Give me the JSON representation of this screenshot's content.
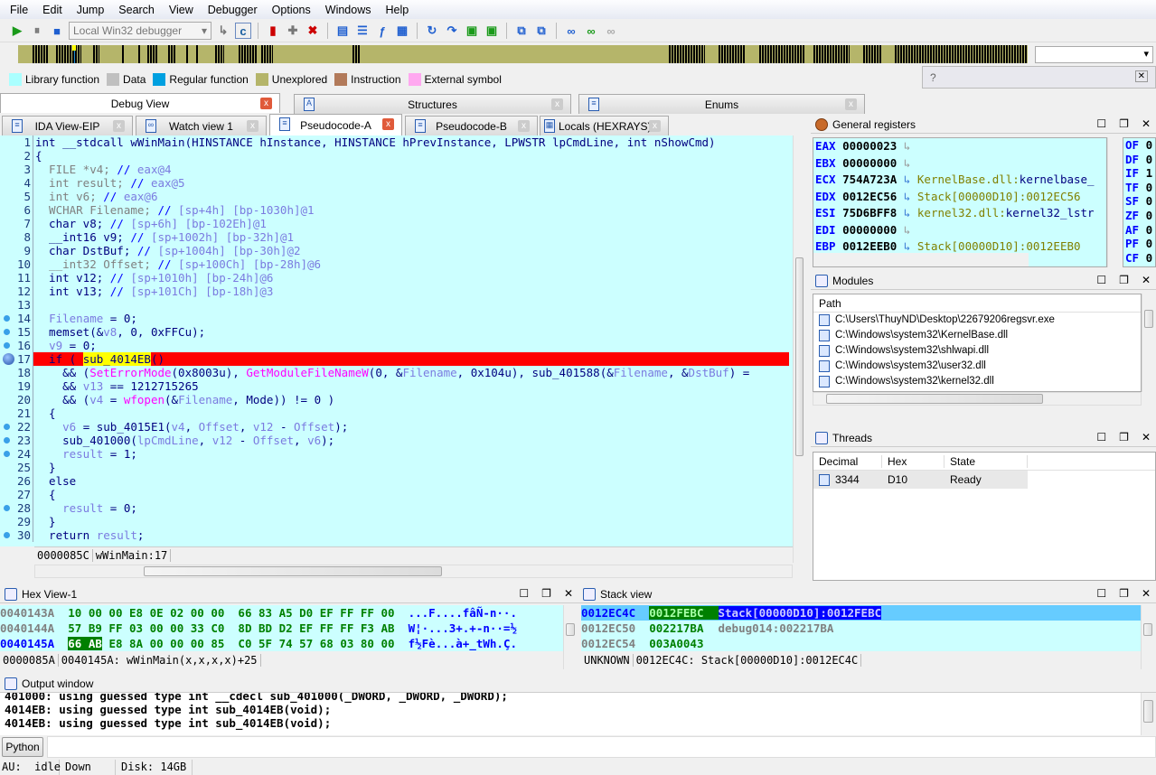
{
  "menu": [
    "File",
    "Edit",
    "Jump",
    "Search",
    "View",
    "Debugger",
    "Options",
    "Windows",
    "Help"
  ],
  "toolbar": {
    "debugger_select": "Local Win32 debugger"
  },
  "legend": [
    {
      "label": "Library function",
      "color": "#aaffff"
    },
    {
      "label": "Data",
      "color": "#c0c0c0"
    },
    {
      "label": "Regular function",
      "color": "#00a0e0"
    },
    {
      "label": "Unexplored",
      "color": "#b5b56a"
    },
    {
      "label": "Instruction",
      "color": "#b27a5a"
    },
    {
      "label": "External symbol",
      "color": "#ffa8f0"
    }
  ],
  "help": "?",
  "top_tabs": [
    {
      "label": "Debug View",
      "active": true
    },
    {
      "label": "Structures"
    },
    {
      "label": "Enums"
    }
  ],
  "view_tabs": [
    {
      "label": "IDA View-EIP"
    },
    {
      "label": "Watch view 1"
    },
    {
      "label": "Pseudocode-A",
      "active": true
    },
    {
      "label": "Pseudocode-B"
    },
    {
      "label": "Locals (HEXRAYS)"
    }
  ],
  "code": {
    "lines": [
      {
        "n": "1",
        "s": [
          [
            "int __stdcall wWinMain(HINSTANCE hInstance, HINSTANCE hPrevInstance, LPWSTR lpCmdLine, int nShowCmd)",
            "n"
          ]
        ]
      },
      {
        "n": "2",
        "s": [
          [
            "{",
            "n"
          ]
        ]
      },
      {
        "n": "3",
        "s": [
          [
            "  FILE *v4;",
            "g"
          ],
          [
            " // ",
            "c"
          ],
          [
            "eax@4",
            "v"
          ]
        ]
      },
      {
        "n": "4",
        "s": [
          [
            "  int result;",
            "g"
          ],
          [
            " // ",
            "c"
          ],
          [
            "eax@5",
            "v"
          ]
        ]
      },
      {
        "n": "5",
        "s": [
          [
            "  int v6;",
            "g"
          ],
          [
            " // ",
            "c"
          ],
          [
            "eax@6",
            "v"
          ]
        ]
      },
      {
        "n": "6",
        "s": [
          [
            "  WCHAR Filename;",
            "g"
          ],
          [
            " // ",
            "c"
          ],
          [
            "[sp+4h] [bp-1030h]@1",
            "v"
          ]
        ]
      },
      {
        "n": "7",
        "s": [
          [
            "  char v8;",
            "n"
          ],
          [
            " // ",
            "c"
          ],
          [
            "[sp+6h] [bp-102Eh]@1",
            "v"
          ]
        ]
      },
      {
        "n": "8",
        "s": [
          [
            "  __int16 v9;",
            "n"
          ],
          [
            " // ",
            "c"
          ],
          [
            "[sp+1002h] [bp-32h]@1",
            "v"
          ]
        ]
      },
      {
        "n": "9",
        "s": [
          [
            "  char DstBuf;",
            "n"
          ],
          [
            " // ",
            "c"
          ],
          [
            "[sp+1004h] [bp-30h]@2",
            "v"
          ]
        ]
      },
      {
        "n": "10",
        "s": [
          [
            "  __int32 Offset;",
            "g"
          ],
          [
            " // ",
            "c"
          ],
          [
            "[sp+100Ch] [bp-28h]@6",
            "v"
          ]
        ]
      },
      {
        "n": "11",
        "s": [
          [
            "  int v12;",
            "n"
          ],
          [
            " // ",
            "c"
          ],
          [
            "[sp+1010h] [bp-24h]@6",
            "v"
          ]
        ]
      },
      {
        "n": "12",
        "s": [
          [
            "  int v13;",
            "n"
          ],
          [
            " // ",
            "c"
          ],
          [
            "[sp+101Ch] [bp-18h]@3",
            "v"
          ]
        ]
      },
      {
        "n": "13",
        "s": [
          [
            "",
            "n"
          ]
        ]
      },
      {
        "n": "14",
        "dot": true,
        "s": [
          [
            "  ",
            "n"
          ],
          [
            "Filename",
            "v"
          ],
          [
            " = 0;",
            "n"
          ]
        ]
      },
      {
        "n": "15",
        "dot": true,
        "s": [
          [
            "  memset(&",
            "n"
          ],
          [
            "v8",
            "v"
          ],
          [
            ", 0, 0xFFCu);",
            "n"
          ]
        ]
      },
      {
        "n": "16",
        "dot": true,
        "s": [
          [
            "  ",
            "n"
          ],
          [
            "v9",
            "v"
          ],
          [
            " = 0;",
            "n"
          ]
        ]
      },
      {
        "n": "17",
        "bp": true,
        "hl": true,
        "s": [
          [
            "  if ( ",
            "n"
          ],
          [
            "sub_4014EB",
            "y"
          ],
          [
            "()",
            "n"
          ]
        ]
      },
      {
        "n": "18",
        "s": [
          [
            "    && (",
            "n"
          ],
          [
            "SetErrorMode",
            "f"
          ],
          [
            "(0x8003u), ",
            "n"
          ],
          [
            "GetModuleFileNameW",
            "f"
          ],
          [
            "(0, &",
            "n"
          ],
          [
            "Filename",
            "v"
          ],
          [
            ", 0x104u), sub_401588(&",
            "n"
          ],
          [
            "Filename",
            "v"
          ],
          [
            ", &",
            "n"
          ],
          [
            "DstBuf",
            "v"
          ],
          [
            ") =",
            "n"
          ]
        ]
      },
      {
        "n": "19",
        "s": [
          [
            "    && ",
            "n"
          ],
          [
            "v13",
            "v"
          ],
          [
            " == 1212715265",
            "n"
          ]
        ]
      },
      {
        "n": "20",
        "s": [
          [
            "    && (",
            "n"
          ],
          [
            "v4",
            "v"
          ],
          [
            " = ",
            "n"
          ],
          [
            "wfopen",
            "f"
          ],
          [
            "(&",
            "n"
          ],
          [
            "Filename",
            "v"
          ],
          [
            ", Mode)) != 0 )",
            "n"
          ]
        ]
      },
      {
        "n": "21",
        "s": [
          [
            "  {",
            "n"
          ]
        ]
      },
      {
        "n": "22",
        "dot": true,
        "s": [
          [
            "    ",
            "n"
          ],
          [
            "v6",
            "v"
          ],
          [
            " = sub_4015E1(",
            "n"
          ],
          [
            "v4",
            "v"
          ],
          [
            ", ",
            "n"
          ],
          [
            "Offset",
            "v"
          ],
          [
            ", ",
            "n"
          ],
          [
            "v12",
            "v"
          ],
          [
            " - ",
            "n"
          ],
          [
            "Offset",
            "v"
          ],
          [
            ");",
            "n"
          ]
        ]
      },
      {
        "n": "23",
        "dot": true,
        "s": [
          [
            "    sub_401000(",
            "n"
          ],
          [
            "lpCmdLine",
            "v"
          ],
          [
            ", ",
            "n"
          ],
          [
            "v12",
            "v"
          ],
          [
            " - ",
            "n"
          ],
          [
            "Offset",
            "v"
          ],
          [
            ", ",
            "n"
          ],
          [
            "v6",
            "v"
          ],
          [
            ");",
            "n"
          ]
        ]
      },
      {
        "n": "24",
        "dot": true,
        "s": [
          [
            "    ",
            "n"
          ],
          [
            "result",
            "v"
          ],
          [
            " = 1;",
            "n"
          ]
        ]
      },
      {
        "n": "25",
        "s": [
          [
            "  }",
            "n"
          ]
        ]
      },
      {
        "n": "26",
        "s": [
          [
            "  else",
            "n"
          ]
        ]
      },
      {
        "n": "27",
        "s": [
          [
            "  {",
            "n"
          ]
        ]
      },
      {
        "n": "28",
        "dot": true,
        "s": [
          [
            "    ",
            "n"
          ],
          [
            "result",
            "v"
          ],
          [
            " = 0;",
            "n"
          ]
        ]
      },
      {
        "n": "29",
        "s": [
          [
            "  }",
            "n"
          ]
        ]
      },
      {
        "n": "30",
        "dot": true,
        "s": [
          [
            "  return ",
            "n"
          ],
          [
            "result",
            "v"
          ],
          [
            ";",
            "n"
          ]
        ]
      }
    ],
    "status_offset": "0000085C",
    "status_location": "wWinMain:17"
  },
  "registers": {
    "title": "General registers",
    "rows": [
      {
        "name": "EAX",
        "value": "00000023",
        "target": "",
        "target2": ""
      },
      {
        "name": "EBX",
        "value": "00000000",
        "target": "",
        "target2": ""
      },
      {
        "name": "ECX",
        "value": "754A723A",
        "target": "KernelBase.dll:",
        "target2": "kernelbase_"
      },
      {
        "name": "EDX",
        "value": "0012EC56",
        "target": "Stack[00000D10]:0012EC56",
        "target2": ""
      },
      {
        "name": "ESI",
        "value": "75D6BFF8",
        "target": "kernel32.dll:",
        "target2": "kernel32_lstr"
      },
      {
        "name": "EDI",
        "value": "00000000",
        "target": "",
        "target2": ""
      },
      {
        "name": "EBP",
        "value": "0012EEB0",
        "target": "Stack[00000D10]:0012EEB0",
        "target2": ""
      }
    ],
    "flags": [
      [
        "OF",
        "0"
      ],
      [
        "DF",
        "0"
      ],
      [
        "IF",
        "1"
      ],
      [
        "TF",
        "0"
      ],
      [
        "SF",
        "0"
      ],
      [
        "ZF",
        "0"
      ],
      [
        "AF",
        "0"
      ],
      [
        "PF",
        "0"
      ],
      [
        "CF",
        "0"
      ]
    ]
  },
  "modules": {
    "title": "Modules",
    "header": "Path",
    "items": [
      "C:\\Users\\ThuyND\\Desktop\\22679206regsvr.exe",
      "C:\\Windows\\system32\\KernelBase.dll",
      "C:\\Windows\\system32\\shlwapi.dll",
      "C:\\Windows\\system32\\user32.dll",
      "C:\\Windows\\system32\\kernel32.dll"
    ]
  },
  "threads": {
    "title": "Threads",
    "columns": [
      "Decimal",
      "Hex",
      "State"
    ],
    "rows": [
      [
        "3344",
        "D10",
        "Ready"
      ]
    ]
  },
  "hex": {
    "title": "Hex View-1",
    "rows": [
      {
        "addr": "0040143A",
        "bytes": "10 00 00 E8 0E 02 00 00  66 83 A5 D0 EF FF FF 00",
        "ascii": "...F....fâÑ-n··."
      },
      {
        "addr": "0040144A",
        "bytes": "57 B9 FF 03 00 00 33 C0  8D BD D2 EF FF FF F3 AB",
        "ascii": "W¦·...3+.+-n··=½"
      },
      {
        "addr": "0040145A",
        "sel": "66 AB",
        "bytes": " E8 8A 00 00 00 85  C0 5F 74 57 68 03 80 00",
        "ascii": "f½Fè...à+_tWh.Ç."
      }
    ],
    "status_offset": "0000085A",
    "status_location": "0040145A: wWinMain(x,x,x,x)+25"
  },
  "stack": {
    "title": "Stack view",
    "rows": [
      {
        "addr": "0012EC4C",
        "value": "0012FEBC",
        "comment": "Stack[00000D10]:0012FEBC",
        "sel": true
      },
      {
        "addr": "0012EC50",
        "value": "002217BA",
        "comment": "debug014:002217BA"
      },
      {
        "addr": "0012EC54",
        "value": "003A0043",
        "comment": ""
      }
    ],
    "status_type": "UNKNOWN",
    "status_location": "0012EC4C: Stack[00000D10]:0012EC4C"
  },
  "output": {
    "title": "Output window",
    "lines": [
      "401000: using guessed type int __cdecl sub_401000(_DWORD, _DWORD, _DWORD);",
      "4014EB: using guessed type int sub_4014EB(void);",
      "4014EB: using guessed type int sub_4014EB(void);"
    ],
    "python_button": "Python",
    "input": ""
  },
  "statusbar": {
    "au": "AU:  idle",
    "direction": "Down",
    "disk": "Disk: 14GB"
  }
}
